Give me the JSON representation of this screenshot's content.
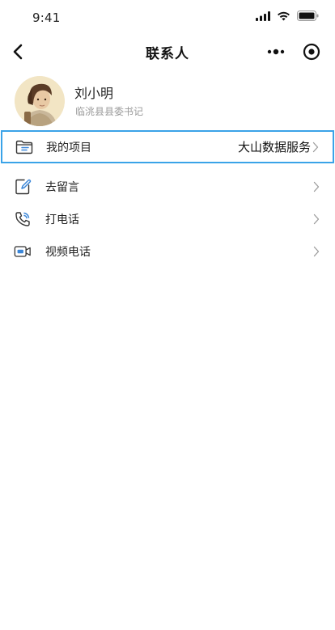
{
  "status_bar": {
    "time": "9:41"
  },
  "nav": {
    "title": "联系人"
  },
  "profile": {
    "name": "刘小明",
    "role": "临洮县县委书记"
  },
  "menu": {
    "items": [
      {
        "label": "我的项目",
        "value": "大山数据服务",
        "icon": "folder-icon"
      },
      {
        "label": "去留言",
        "value": "",
        "icon": "edit-note-icon"
      },
      {
        "label": "打电话",
        "value": "",
        "icon": "phone-icon"
      },
      {
        "label": "视频电话",
        "value": "",
        "icon": "video-call-icon"
      }
    ]
  },
  "colors": {
    "highlight_border": "#3aa3e8",
    "icon_accent": "#3a86d8",
    "secondary_text": "#9a9a9a"
  }
}
